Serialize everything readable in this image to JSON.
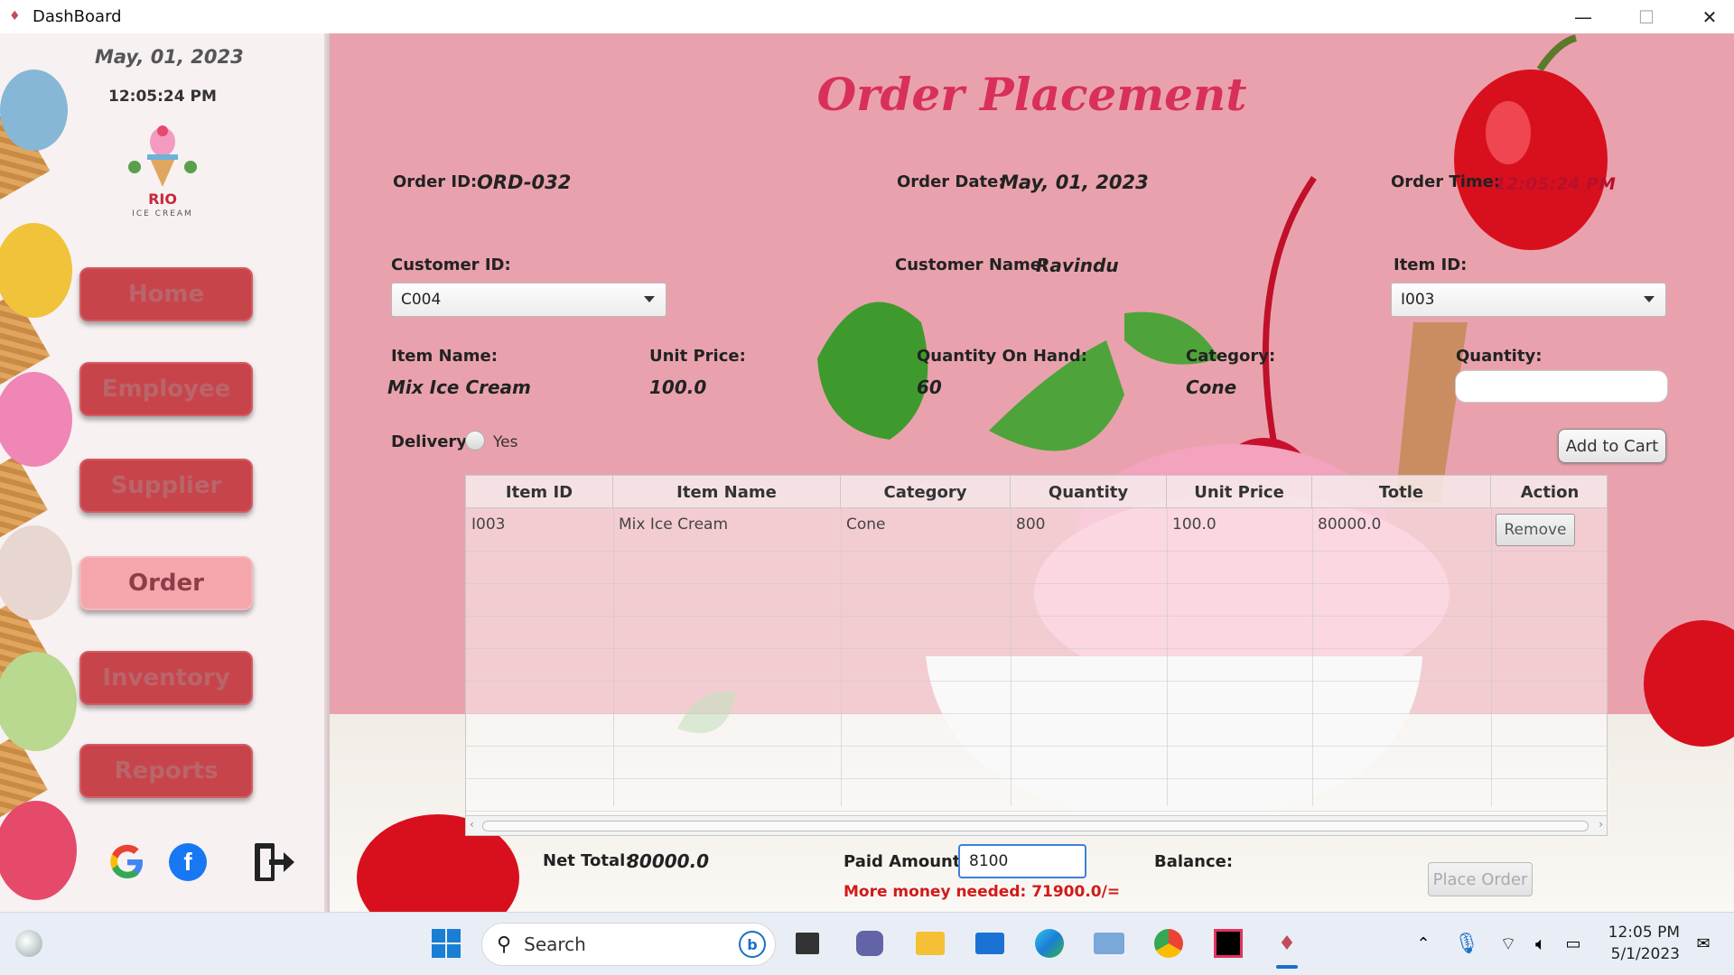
{
  "window": {
    "title": "DashBoard",
    "minimize": "—",
    "maximize": "☐",
    "close": "✕"
  },
  "sidebar": {
    "date": "May,  01, 2023",
    "time": "12:05:24 PM",
    "logo_text": "RIO",
    "logo_sub": "ICE CREAM",
    "nav": [
      {
        "label": "Home",
        "active": false
      },
      {
        "label": "Employee",
        "active": false
      },
      {
        "label": "Supplier",
        "active": false
      },
      {
        "label": "Order",
        "active": true
      },
      {
        "label": "Inventory",
        "active": false
      },
      {
        "label": "Reports",
        "active": false
      }
    ],
    "social": [
      "google-icon",
      "facebook-icon",
      "logout-icon"
    ]
  },
  "main": {
    "title": "Order Placement",
    "order_id_label": "Order ID:",
    "order_id": "ORD-032",
    "order_date_label": "Order Date:",
    "order_date": "May,  01, 2023",
    "order_time_label": "Order Time:",
    "order_time": "12:05:24 PM",
    "customer_id_label": "Customer ID:",
    "customer_id": "C004",
    "customer_name_label": "Customer Name:",
    "customer_name": "Ravindu",
    "item_id_label": "Item ID:",
    "item_id": "I003",
    "item_name_label": "Item Name:",
    "item_name": "Mix Ice Cream",
    "unit_price_label": "Unit Price:",
    "unit_price": "100.0",
    "qoh_label": "Quantity On Hand:",
    "qoh": "60",
    "category_label": "Category:",
    "category": "Cone",
    "quantity_label": "Quantity:",
    "quantity": "",
    "delivery_label": "Delivery",
    "delivery_option": "Yes",
    "add_to_cart": "Add to Cart"
  },
  "table": {
    "columns": [
      "Item ID",
      "Item Name",
      "Category",
      "Quantity",
      "Unit Price",
      "Totle",
      "Action"
    ],
    "rows": [
      {
        "item_id": "I003",
        "item_name": "Mix Ice Cream",
        "category": "Cone",
        "quantity": "800",
        "unit_price": "100.0",
        "total": "80000.0",
        "action": "Remove"
      }
    ]
  },
  "footer": {
    "net_total_label": "Net Total:",
    "net_total": "80000.0",
    "paid_label": "Paid Amount:",
    "paid_value": "8100",
    "balance_label": "Balance:",
    "warning": "More money needed:  71900.0/=",
    "place_order": "Place Order"
  },
  "taskbar": {
    "search": "Search",
    "time": "12:05 PM",
    "date": "5/1/2023"
  },
  "colors": {
    "accent": "#d8305a",
    "nav_button": "#c8444b",
    "nav_active": "#f5a6ad",
    "main_bg": "#e9a2ad"
  }
}
